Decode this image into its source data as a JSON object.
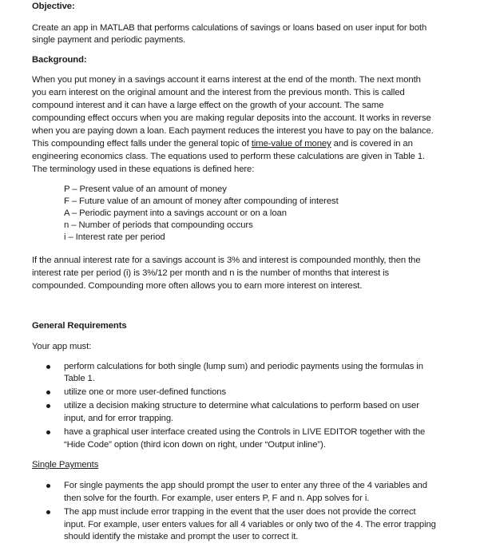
{
  "objective": {
    "heading": "Objective:",
    "lines": [
      "Create an app in MATLAB that performs calculations of savings or loans based on user input for both",
      "single payment and periodic payments."
    ]
  },
  "background": {
    "heading": "Background:",
    "lines": [
      "When you put money in a savings account it earns interest at the end of the month.  The next month",
      "you earn interest on the original amount and the interest from the previous month.  This is called",
      "compound interest and it can have a large effect on the growth of your account.  The same",
      "compounding effect occurs when you are making regular deposits into the account.  It works in reverse",
      "when you are paying down a loan.  Each payment reduces the interest you have to pay on the balance.",
      "engineering economics class.  The equations used to perform these calculations are given in Table 1.",
      "The terminology used in these equations is defined here:"
    ],
    "line6_pre": "This compounding effect falls under the general topic of ",
    "line6_link": "time-value of money",
    "line6_post": " and is covered in an",
    "terms": [
      "P – Present value of an amount of money",
      "F – Future value of an amount of money after compounding of interest",
      "A – Periodic payment into a savings account or on a loan",
      "n – Number of periods that compounding occurs",
      "i – Interest rate per period"
    ],
    "example_lines": [
      "If the annual interest rate for a savings account is 3% and interest is compounded monthly, then the",
      "interest rate per period (i) is 3%/12 per month and n is the number of months that interest is",
      "compounded.  Compounding more often allows you to earn more interest on interest."
    ]
  },
  "general": {
    "heading": "General Requirements",
    "intro": "Your app must:",
    "bullets": [
      [
        "perform calculations for both single (lump sum) and periodic payments using the formulas in",
        "Table 1."
      ],
      [
        "utilize one or more user-defined functions"
      ],
      [
        "utilize a decision making structure to determine what calculations to perform based on user",
        "input, and for error trapping."
      ],
      [
        "have a graphical user interface created using the Controls in LIVE EDITOR together with the",
        "“Hide Code” option (third icon down on right, under “Output inline”)."
      ]
    ]
  },
  "single": {
    "heading": "Single Payments",
    "bullets": [
      [
        "For single payments the app should prompt the user to enter any three of the 4 variables and",
        "then solve for the fourth.  For example, user enters P, F and n.  App solves for i."
      ],
      [
        "The app must include error trapping in the event that the user does not provide the correct",
        "input. For example, user enters values for all 4 variables or only two of the 4.  The error trapping",
        "should identify the mistake and prompt the user to correct it."
      ]
    ]
  }
}
